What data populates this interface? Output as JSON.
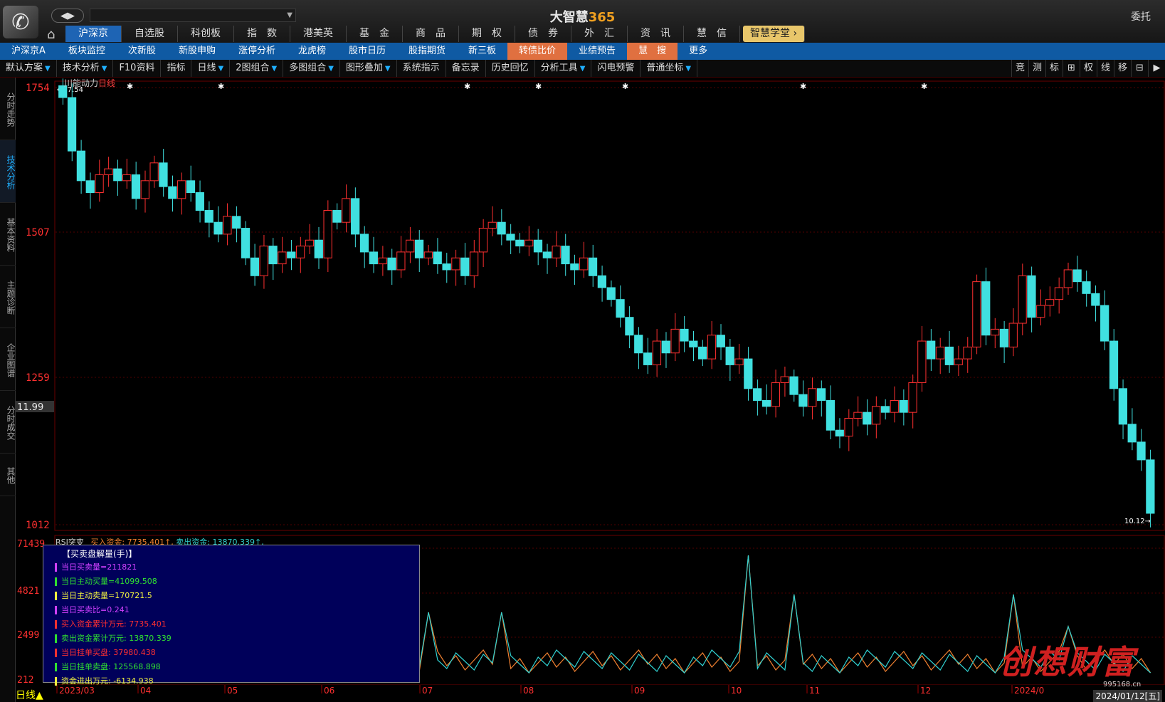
{
  "app": {
    "title_main": "大智慧",
    "title_num": "365",
    "weituo": "委托",
    "url_text": ""
  },
  "main_tabs": [
    {
      "label": "沪深京",
      "selected": true
    },
    {
      "label": "自选股"
    },
    {
      "label": "科创板"
    },
    {
      "label": "指　数"
    },
    {
      "label": "港美英"
    },
    {
      "label": "基　金"
    },
    {
      "label": "商　品"
    },
    {
      "label": "期　权"
    },
    {
      "label": "债　券"
    },
    {
      "label": "外　汇"
    },
    {
      "label": "资　讯"
    },
    {
      "label": "慧　信"
    },
    {
      "label": "智慧学堂 ›",
      "academy": true
    }
  ],
  "sub_tabs": [
    {
      "label": "沪深京A"
    },
    {
      "label": "板块监控"
    },
    {
      "label": "次新股"
    },
    {
      "label": "新股申购"
    },
    {
      "label": "涨停分析"
    },
    {
      "label": "龙虎榜"
    },
    {
      "label": "股市日历"
    },
    {
      "label": "股指期货"
    },
    {
      "label": "新三板"
    },
    {
      "label": "转债比价",
      "orange": true
    },
    {
      "label": "业绩预告"
    },
    {
      "label": "慧　搜",
      "orange": true
    },
    {
      "label": "更多"
    }
  ],
  "toolbar": [
    {
      "label": "默认方案",
      "dd": true
    },
    {
      "label": "技术分析",
      "dd": true
    },
    {
      "label": "F10资料"
    },
    {
      "label": "指标"
    },
    {
      "label": "日线",
      "dd": true
    },
    {
      "label": "2图组合",
      "dd": true
    },
    {
      "label": "多图组合",
      "dd": true
    },
    {
      "label": "图形叠加",
      "dd": true
    },
    {
      "label": "系统指示"
    },
    {
      "label": "备忘录"
    },
    {
      "label": "历史回忆"
    },
    {
      "label": "分析工具",
      "dd": true
    },
    {
      "label": "闪电预警"
    },
    {
      "label": "普通坐标",
      "dd": true
    }
  ],
  "right_tools": [
    "竞",
    "测",
    "标",
    "⊞",
    "权",
    "线",
    "移",
    "⊟",
    "▶"
  ],
  "sidebar": [
    {
      "label": "分时走势"
    },
    {
      "label": "技术分析",
      "selected": true
    },
    {
      "label": "基本资料"
    },
    {
      "label": "主题诊断"
    },
    {
      "label": "企业图谱"
    },
    {
      "label": "分时成交"
    },
    {
      "label": "其他"
    }
  ],
  "stock": {
    "name": "川能动力",
    "period": "日线"
  },
  "price_axis": {
    "labels": [
      "1754",
      "1507",
      "1259",
      "1012"
    ],
    "current": "11.99",
    "high_mark": "←17.54",
    "low_mark": "10.12→"
  },
  "rsi_panel": {
    "title": "RSI突变",
    "buy_label": "买入资金:",
    "buy_val": "7735.401↑,",
    "sell_label": "卖出资金:",
    "sell_val": "13870.339↑,",
    "axis_labels": [
      "71439",
      "4821",
      "2499",
      "212"
    ]
  },
  "tooltip": {
    "title": "【买卖盘解量(手)】",
    "rows": [
      {
        "text": "当日买卖量=211821",
        "color": "#d040ff"
      },
      {
        "text": "当日主动买量=41099.508",
        "color": "#30e030"
      },
      {
        "text": "当日主动卖量=170721.5",
        "color": "#f0f040"
      },
      {
        "text": "当日买卖比=0.241",
        "color": "#d040ff"
      },
      {
        "text": "买入资金累计万元: 7735.401",
        "color": "#ff3030"
      },
      {
        "text": "卖出资金累计万元: 13870.339",
        "color": "#30e030"
      },
      {
        "text": "当日挂单买盘: 37980.438",
        "color": "#ff3030"
      },
      {
        "text": "当日挂单卖盘: 125568.898",
        "color": "#30e030"
      },
      {
        "text": "资金进出万元: -6134.938",
        "color": "#f0f040"
      }
    ]
  },
  "date_axis": [
    "2023/03",
    "04",
    "05",
    "06",
    "07",
    "08",
    "09",
    "10",
    "11",
    "12",
    "2024/0"
  ],
  "date_info": "2024/01/12[五]",
  "bottom_label": "日线▲",
  "watermark": "创想财富",
  "watermark_url": "995168.cn",
  "colors": {
    "up": "#ff3030",
    "down": "#40e0e0",
    "accent": "#1e64b4",
    "orange": "#e07040"
  },
  "chart_data": {
    "type": "candlestick",
    "note_series": "daily price",
    "x_start": "2023/03",
    "x_end": "2024/01/12",
    "y_range": [
      10.12,
      17.54
    ],
    "series": [
      {
        "name": "close_approx",
        "values": [
          17.3,
          16.4,
          15.9,
          15.7,
          16.0,
          16.1,
          15.9,
          16.0,
          15.6,
          15.9,
          16.2,
          15.8,
          15.6,
          15.9,
          15.7,
          15.4,
          15.2,
          15.0,
          15.3,
          15.1,
          14.6,
          14.3,
          14.8,
          14.5,
          14.7,
          14.6,
          14.8,
          14.9,
          14.6,
          15.4,
          15.2,
          15.6,
          15.0,
          14.7,
          14.5,
          14.6,
          14.4,
          14.7,
          14.9,
          14.6,
          14.7,
          14.5,
          14.4,
          14.6,
          14.3,
          14.7,
          15.1,
          15.2,
          15.0,
          14.9,
          14.8,
          14.9,
          14.7,
          14.6,
          14.8,
          14.5,
          14.4,
          14.6,
          14.3,
          14.1,
          13.9,
          13.6,
          13.3,
          13.0,
          12.8,
          13.2,
          13.0,
          13.4,
          13.2,
          13.1,
          12.9,
          13.3,
          13.1,
          12.8,
          12.9,
          12.4,
          12.2,
          12.1,
          12.5,
          12.6,
          12.3,
          12.1,
          12.4,
          12.2,
          11.7,
          11.6,
          11.9,
          12.0,
          11.8,
          12.1,
          12.0,
          12.2,
          12.0,
          12.5,
          13.2,
          12.9,
          13.1,
          12.8,
          12.9,
          13.1,
          14.2,
          13.3,
          13.4,
          13.1,
          13.5,
          14.3,
          13.6,
          13.8,
          13.9,
          14.1,
          14.4,
          14.2,
          14.0,
          13.8,
          13.2,
          12.4,
          11.8,
          11.5,
          11.2,
          10.3
        ]
      }
    ],
    "rsi_lines": [
      "orange",
      "cyan"
    ]
  }
}
